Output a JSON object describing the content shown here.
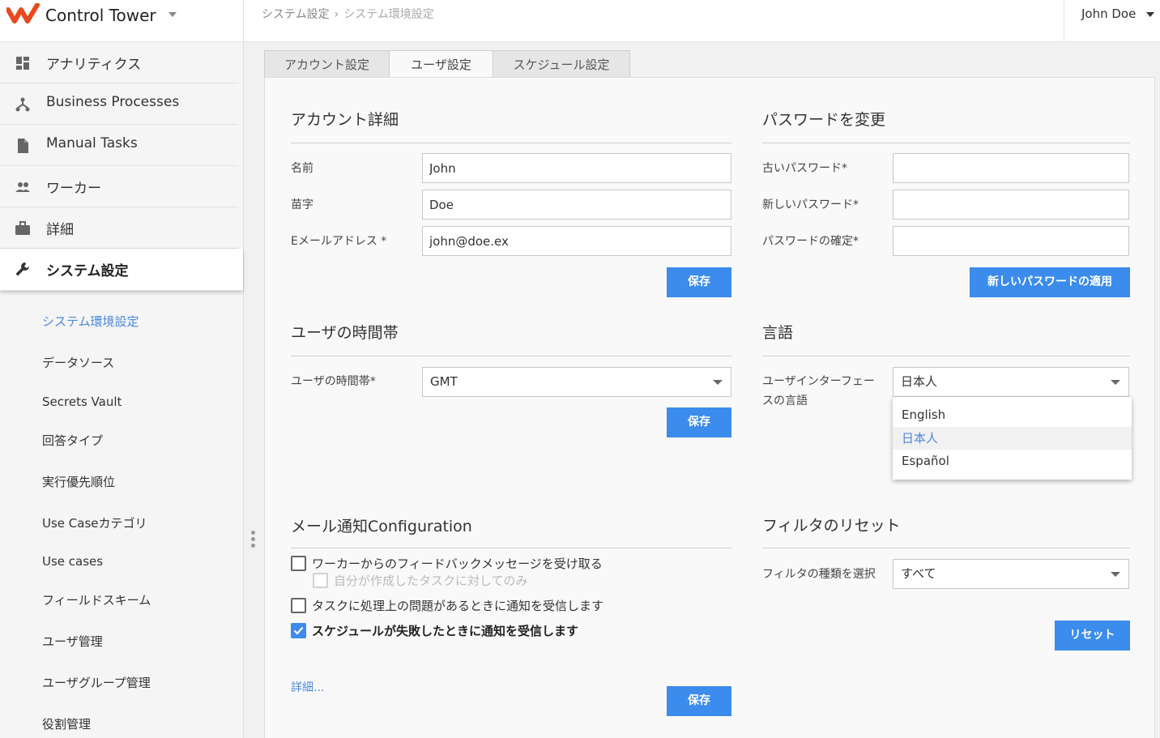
{
  "app": {
    "title": "Control Tower"
  },
  "header": {
    "breadcrumb": [
      "システム設定",
      "システム環境設定"
    ],
    "user_name": "John Doe"
  },
  "sidebar": {
    "items": [
      {
        "label": "アナリティクス",
        "icon": "dashboard-icon"
      },
      {
        "label": "Business Processes",
        "icon": "process-tree-icon"
      },
      {
        "label": "Manual Tasks",
        "icon": "document-icon"
      },
      {
        "label": "ワーカー",
        "icon": "people-icon"
      },
      {
        "label": "詳細",
        "icon": "briefcase-icon"
      },
      {
        "label": "システム設定",
        "icon": "wrench-icon"
      }
    ],
    "subitems": [
      "システム環境設定",
      "データソース",
      "Secrets Vault",
      "回答タイプ",
      "実行優先順位",
      "Use Caseカテゴリ",
      "Use cases",
      "フィールドスキーム",
      "ユーザ管理",
      "ユーザグループ管理",
      "役割管理"
    ]
  },
  "tabs": [
    "アカウント設定",
    "ユーザ設定",
    "スケジュール設定"
  ],
  "account": {
    "title": "アカウント詳細",
    "first_name_label": "名前",
    "first_name_value": "John",
    "last_name_label": "苗字",
    "last_name_value": "Doe",
    "email_label": "Eメールアドレス *",
    "email_value": "john@doe.ex",
    "save_label": "保存"
  },
  "password": {
    "title": "パスワードを変更",
    "old_label": "古いパスワード*",
    "new_label": "新しいパスワード*",
    "confirm_label": "パスワードの確定*",
    "apply_label": "新しいパスワードの適用"
  },
  "timezone": {
    "title": "ユーザの時間帯",
    "label": "ユーザの時間帯*",
    "value": "GMT",
    "save_label": "保存"
  },
  "language": {
    "title": "言語",
    "label": "ユーザインターフェースの言語",
    "value": "日本人",
    "options": [
      "English",
      "日本人",
      "Español"
    ]
  },
  "mail": {
    "title": "メール通知Configuration",
    "opt1": "ワーカーからのフィードバックメッセージを受け取る",
    "opt1_sub": "自分が作成したタスクに対してのみ",
    "opt2": "タスクに処理上の問題があるときに通知を受信します",
    "opt3": "スケジュールが失敗したときに通知を受信します",
    "more_link": "詳細...",
    "save_label": "保存"
  },
  "filter": {
    "title": "フィルタのリセット",
    "label": "フィルタの種類を選択",
    "value": "すべて",
    "reset_label": "リセット"
  },
  "colors": {
    "accent": "#3b8cec",
    "link": "#4a89dc",
    "brand": "#e8491d"
  }
}
